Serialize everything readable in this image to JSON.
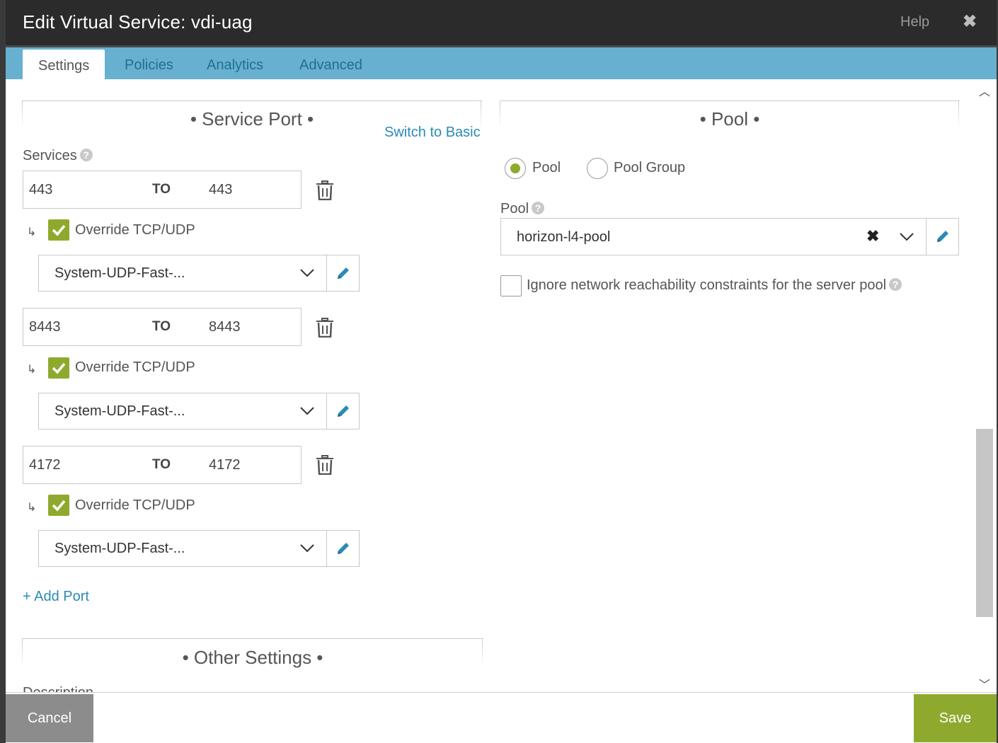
{
  "window": {
    "title": "Edit Virtual Service: vdi-uag",
    "help_label": "Help",
    "close_glyph": "✖"
  },
  "tabs": [
    {
      "label": "Settings",
      "active": true
    },
    {
      "label": "Policies",
      "active": false
    },
    {
      "label": "Analytics",
      "active": false
    },
    {
      "label": "Advanced",
      "active": false
    }
  ],
  "service_port": {
    "heading": "• Service Port •",
    "switch_link": "Switch to Basic",
    "services_label": "Services",
    "to_label": "TO",
    "override_label": "Override TCP/UDP",
    "ports": [
      {
        "from": "443",
        "to": "443",
        "override": true,
        "profile": "System-UDP-Fast-..."
      },
      {
        "from": "8443",
        "to": "8443",
        "override": true,
        "profile": "System-UDP-Fast-..."
      },
      {
        "from": "4172",
        "to": "4172",
        "override": true,
        "profile": "System-UDP-Fast-..."
      }
    ],
    "add_port": "+ Add Port"
  },
  "other_settings": {
    "heading": "• Other Settings •",
    "description_label": "Description"
  },
  "pool": {
    "heading": "• Pool •",
    "radio_pool": "Pool",
    "radio_pool_group": "Pool Group",
    "selected_radio": "Pool",
    "pool_label": "Pool",
    "pool_value": "horizon-l4-pool",
    "ignore_label": "Ignore network reachability constraints for the server pool",
    "ignore_checked": false
  },
  "footer": {
    "cancel_label": "Cancel",
    "save_label": "Save"
  },
  "colors": {
    "accent_green": "#8eaa2e",
    "tab_bar_blue": "#68b0cf",
    "link_blue": "#2b8bb5"
  }
}
